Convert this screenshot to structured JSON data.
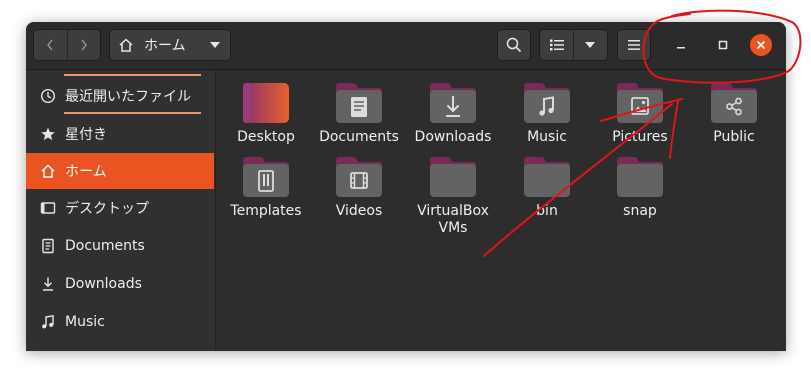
{
  "header": {
    "path_label": "ホーム"
  },
  "sidebar": {
    "items": [
      {
        "label": "最近開いたファイル",
        "icon": "clock-icon"
      },
      {
        "label": "星付き",
        "icon": "star-icon"
      },
      {
        "label": "ホーム",
        "icon": "home-icon"
      },
      {
        "label": "デスクトップ",
        "icon": "desktop-icon"
      },
      {
        "label": "Documents",
        "icon": "document-icon"
      },
      {
        "label": "Downloads",
        "icon": "download-icon"
      },
      {
        "label": "Music",
        "icon": "music-icon"
      }
    ]
  },
  "files": [
    {
      "label": "Desktop",
      "icon": "desktop-folder-icon"
    },
    {
      "label": "Documents",
      "icon": "document-folder-icon"
    },
    {
      "label": "Downloads",
      "icon": "download-folder-icon"
    },
    {
      "label": "Music",
      "icon": "music-folder-icon"
    },
    {
      "label": "Pictures",
      "icon": "pictures-folder-icon"
    },
    {
      "label": "Public",
      "icon": "share-folder-icon"
    },
    {
      "label": "Templates",
      "icon": "templates-folder-icon"
    },
    {
      "label": "Videos",
      "icon": "video-folder-icon"
    },
    {
      "label": "VirtualBox VMs",
      "icon": "folder-icon"
    },
    {
      "label": "bin",
      "icon": "folder-icon"
    },
    {
      "label": "snap",
      "icon": "folder-icon"
    }
  ],
  "colors": {
    "accent": "#e95420",
    "annotation": "#e0141a"
  }
}
